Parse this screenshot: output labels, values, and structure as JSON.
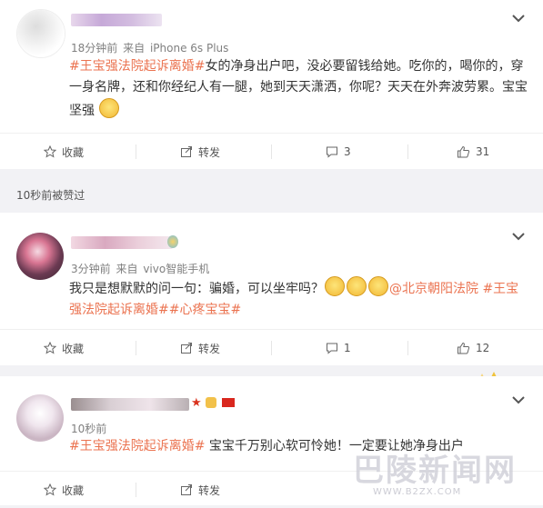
{
  "posts": [
    {
      "meta_time": "18分钟前",
      "meta_from": "来自",
      "meta_device": "iPhone 6s Plus",
      "tag1": "#王宝强法院起诉离婚#",
      "text": "女的净身出户吧，没必要留钱给她。吃你的，喝你的，穿一身名牌，还和你经纪人有一腿，她到天天潇洒，你呢？天天在外奔波劳累。宝宝坚强",
      "actions": {
        "collect": "收藏",
        "forward": "转发",
        "comment": "3",
        "like": "31"
      }
    },
    {
      "meta_time": "3分钟前",
      "meta_from": "来自",
      "meta_device": "vivo智能手机",
      "text": "我只是想默默的问一句：骗婚，可以坐牢吗？",
      "mention": "@北京朝阳法院",
      "tag1": "#王宝强法院起诉离婚#",
      "tag2": "#心疼宝宝#",
      "actions": {
        "collect": "收藏",
        "forward": "转发",
        "comment": "1",
        "like": "12"
      }
    },
    {
      "meta_time": "10秒前",
      "tag1": "#王宝强法院起诉离婚#",
      "text": " 宝宝千万别心软可怜她！一定要让她净身出户",
      "actions": {
        "collect": "收藏",
        "forward": "转发"
      }
    }
  ],
  "separator_label": "10秒前被赞过",
  "watermark": {
    "text": "巴陵新闻网",
    "url": "WWW.B2ZX.COM"
  },
  "colors": {
    "tag": "#eb7350",
    "meta": "#808080",
    "bg": "#f2f2f5"
  },
  "icons": [
    "star-icon",
    "share-icon",
    "comment-icon",
    "thumb-up-icon",
    "chevron-down-icon"
  ]
}
